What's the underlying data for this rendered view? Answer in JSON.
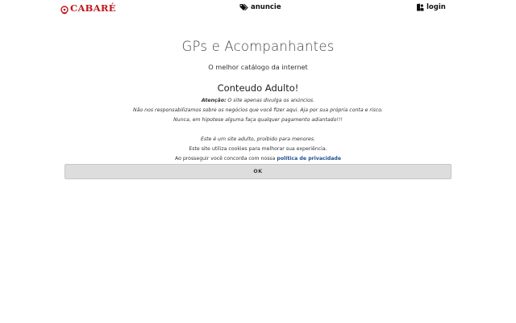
{
  "header": {
    "logo_text": "CABARÉ",
    "anuncie_label": "anuncie",
    "login_label": "login",
    "brand_color": "#c0141b"
  },
  "main": {
    "title": "GPs e Acompanhantes",
    "subtitle": "O melhor catálogo da internet",
    "adult_heading": "Conteudo Adulto!",
    "attention_label": "Atenção:",
    "attention_text": " O site apenas divulga os anúncios.",
    "disclaimer_1": "Não nos responsabilizamos sobre os negócios que você fizer aqui. Aja por sua própria conta e risco.",
    "disclaimer_2": "Nunca, em hipotese alguma faça qualquer pagamento adiantado!!!",
    "minors_notice": "Este é um site adulto, proibido para menores.",
    "cookies_notice": "Este site utiliza cookies para melhorar sua experiência.",
    "consent_text": "Ao prosseguir você concorda com nossa ",
    "privacy_link": "política de privacidade",
    "ok_label": "OK"
  },
  "icons": {
    "anuncie": "tags-icon",
    "login": "user-door-icon",
    "logo": "cabare-logo-icon"
  },
  "colors": {
    "link": "#1f4e8c",
    "button_bg": "#dddddd"
  }
}
